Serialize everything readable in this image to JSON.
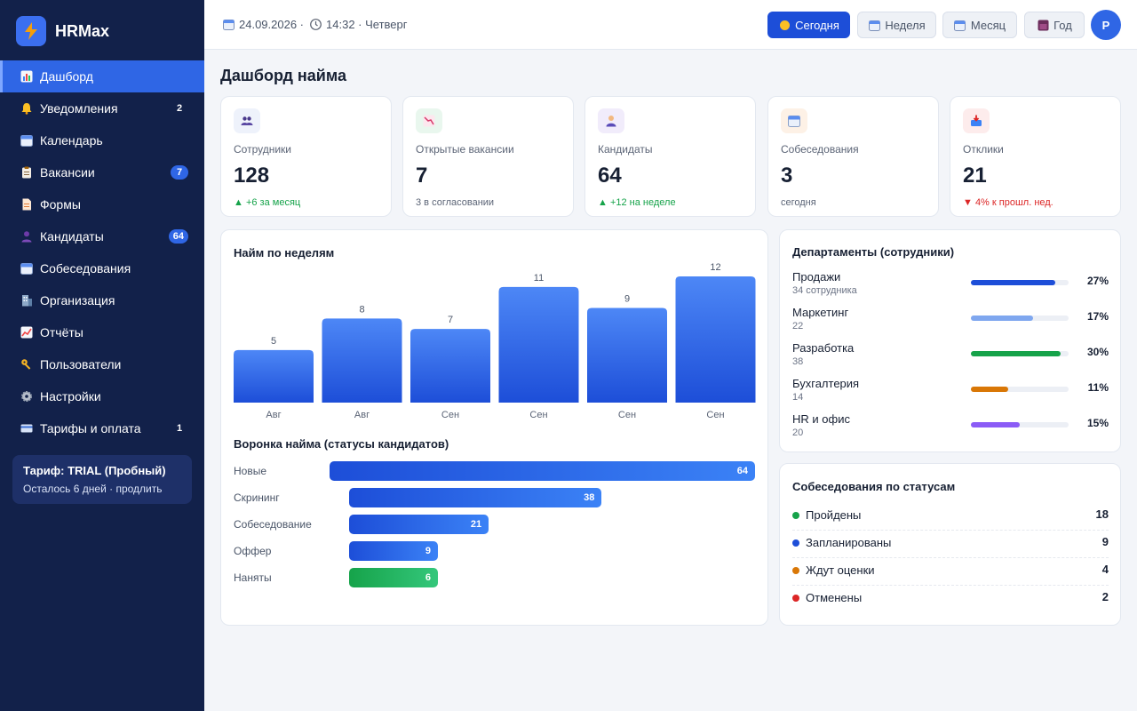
{
  "app": {
    "name": "HRMax",
    "logo_icon": "lightning-icon"
  },
  "sidebar": {
    "items": [
      {
        "label": "Дашборд",
        "icon": "chart-icon",
        "badge": "",
        "active": true
      },
      {
        "label": "Уведомления",
        "icon": "bell-icon",
        "badge": "2",
        "active": false
      },
      {
        "label": "Календарь",
        "icon": "calendar-icon",
        "badge": "",
        "active": false
      },
      {
        "label": "Вакансии",
        "icon": "clipboard-icon",
        "badge": "7",
        "active": false
      },
      {
        "label": "Формы",
        "icon": "document-icon",
        "badge": "",
        "active": false
      },
      {
        "label": "Кандидаты",
        "icon": "person-icon",
        "badge": "64",
        "active": false
      },
      {
        "label": "Собеседования",
        "icon": "calendar-icon",
        "badge": "",
        "active": false
      },
      {
        "label": "Организация",
        "icon": "building-icon",
        "badge": "",
        "active": false
      },
      {
        "label": "Отчёты",
        "icon": "trend-icon",
        "badge": "",
        "active": false
      },
      {
        "label": "Пользователи",
        "icon": "key-icon",
        "badge": "",
        "active": false
      },
      {
        "label": "Настройки",
        "icon": "gear-icon",
        "badge": "",
        "active": false
      },
      {
        "label": "Тарифы и оплата",
        "icon": "card-icon",
        "badge": "1",
        "active": false
      }
    ],
    "plan": {
      "title": "Тариф: TRIAL (Пробный)",
      "subtitle": "Осталось 6 дней · продлить"
    }
  },
  "header": {
    "date": "24.09.2026 ·",
    "time": "14:32 · Четверг",
    "periods": [
      {
        "label": "Сегодня",
        "icon": "sun-icon",
        "active": true
      },
      {
        "label": "Неделя",
        "icon": "calendar-icon",
        "active": false
      },
      {
        "label": "Месяц",
        "icon": "calendar-icon",
        "active": false
      },
      {
        "label": "Год",
        "icon": "year-icon",
        "active": false
      }
    ],
    "avatar": "Р"
  },
  "page": {
    "title": "Дашборд найма"
  },
  "stats": [
    {
      "label": "Сотрудники",
      "value": "128",
      "note": "▲ +6 за месяц",
      "trend": "up",
      "icon": "people-icon",
      "color": "#eef2fb"
    },
    {
      "label": "Открытые вакансии",
      "value": "7",
      "note": "3 в согласовании",
      "trend": "neutral",
      "icon": "chart-down-icon",
      "color": "#e9f7ee"
    },
    {
      "label": "Кандидаты",
      "value": "64",
      "note": "▲ +12 на неделе",
      "trend": "up",
      "icon": "candidate-icon",
      "color": "#f1ecfb"
    },
    {
      "label": "Собеседования",
      "value": "3",
      "note": "сегодня",
      "trend": "neutral",
      "icon": "calendar-icon",
      "color": "#fdf1e6"
    },
    {
      "label": "Отклики",
      "value": "21",
      "note": "▼ 4% к прошл. нед.",
      "trend": "down",
      "icon": "inbox-icon",
      "color": "#fdecec"
    }
  ],
  "weekly": {
    "title": "Найм по неделям",
    "chart_data": {
      "type": "bar",
      "categories": [
        "Авг",
        "Авг",
        "Сен",
        "Сен",
        "Сен",
        "Сен"
      ],
      "values": [
        5,
        8,
        7,
        11,
        9,
        12
      ],
      "title": "Найм по неделям",
      "xlabel": "",
      "ylabel": "",
      "ylim": [
        0,
        12
      ]
    }
  },
  "funnel": {
    "title": "Воронка найма (статусы кандидатов)",
    "chart_data": {
      "type": "bar",
      "orientation": "horizontal",
      "categories": [
        "Новые",
        "Скрининг",
        "Собеседование",
        "Оффер",
        "Наняты"
      ],
      "values": [
        64,
        38,
        21,
        9,
        6
      ],
      "title": "Воронка найма (статусы кандидатов)"
    }
  },
  "departments": {
    "title": "Департаменты (сотрудники)",
    "items": [
      {
        "name": "Продажи",
        "sub": "34 сотрудника",
        "pct": "27%",
        "fill": 0.86,
        "color": "#1d4ed8"
      },
      {
        "name": "Маркетинг",
        "sub": "22",
        "pct": "17%",
        "fill": 0.64,
        "color": "#7fa7ef"
      },
      {
        "name": "Разработка",
        "sub": "38",
        "pct": "30%",
        "fill": 0.92,
        "color": "#16a34a"
      },
      {
        "name": "Бухгалтерия",
        "sub": "14",
        "pct": "11%",
        "fill": 0.38,
        "color": "#d97706"
      },
      {
        "name": "HR и офис",
        "sub": "20",
        "pct": "15%",
        "fill": 0.5,
        "color": "#8b5cf6"
      }
    ]
  },
  "interviews": {
    "title": "Собеседования по статусам",
    "items": [
      {
        "label": "Пройдены",
        "count": "18",
        "color": "#16a34a"
      },
      {
        "label": "Запланированы",
        "count": "9",
        "color": "#1d4ed8"
      },
      {
        "label": "Ждут оценки",
        "count": "4",
        "color": "#d97706"
      },
      {
        "label": "Отменены",
        "count": "2",
        "color": "#dc2626"
      }
    ]
  }
}
